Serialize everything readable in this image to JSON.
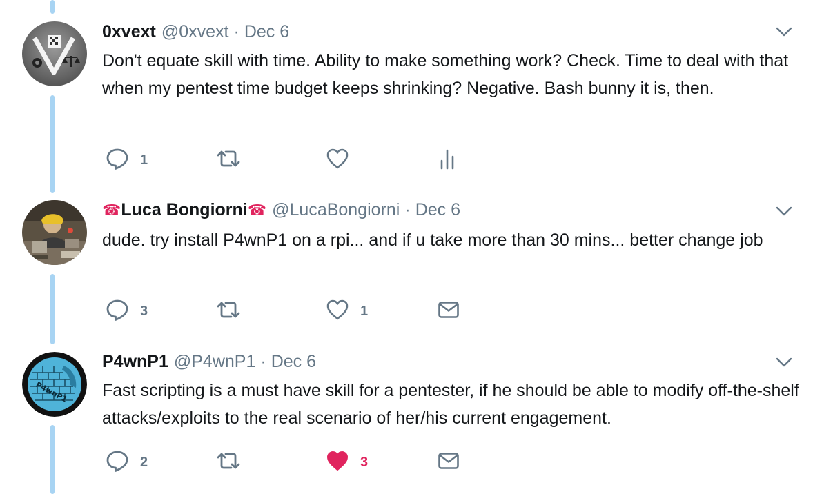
{
  "tweets": [
    {
      "name": "0xvext",
      "handle": "@0xvext",
      "separator": "·",
      "date": "Dec 6",
      "text": "Don't equate skill with time. Ability to make something work? Check. Time to deal with that when my pentest time budget keeps shrinking? Negative. Bash bunny it is, then.",
      "actions": {
        "reply_count": "1",
        "retweet_count": "",
        "like_count": "",
        "fourth_icon": "analytics-icon",
        "liked": false
      }
    },
    {
      "name": "Luca Bongiorni",
      "name_prefix_emoji": "☎",
      "name_suffix_emoji": "☎",
      "handle": "@LucaBongiorni",
      "separator": "·",
      "date": "Dec 6",
      "text": "dude. try install P4wnP1 on a rpi... and if u take more than 30 mins... better change job",
      "actions": {
        "reply_count": "3",
        "retweet_count": "",
        "like_count": "1",
        "fourth_icon": "direct-message-icon",
        "liked": false
      }
    },
    {
      "name": "P4wnP1",
      "handle": "@P4wnP1",
      "separator": "·",
      "date": "Dec 6",
      "text": "Fast scripting is a must have skill for a pentester, if he should be able to modify off-the-shelf attacks/exploits to the real scenario of her/his current engagement.",
      "actions": {
        "reply_count": "2",
        "retweet_count": "",
        "like_count": "3",
        "fourth_icon": "direct-message-icon",
        "liked": true
      }
    }
  ],
  "colors": {
    "thread_line": "#a8d4f3",
    "text": "#14171a",
    "muted": "#657786",
    "like_active": "#e0245e"
  }
}
